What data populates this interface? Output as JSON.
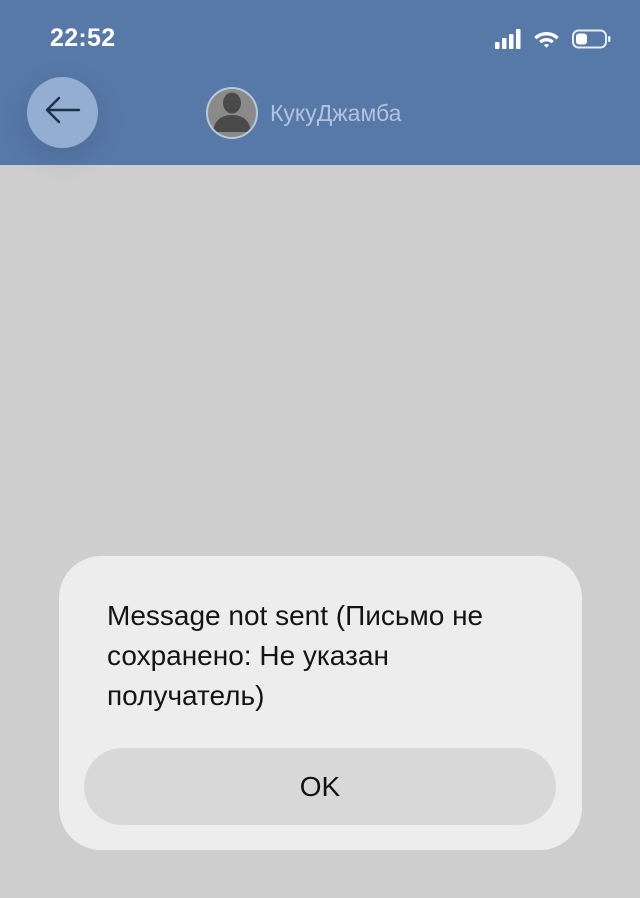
{
  "status_bar": {
    "time": "22:52",
    "icons": [
      "signal-icon",
      "wifi-icon",
      "battery-icon"
    ]
  },
  "header": {
    "back_icon": "arrow-left-icon",
    "contact_name": "КукуДжамба",
    "avatar_icon": "person-silhouette-icon"
  },
  "dialog": {
    "message": "Message not sent (Письмо не сохранено: Не указан получатель)",
    "ok_label": "OK"
  },
  "colors": {
    "header_bg": "#5779a8",
    "back_button_bg": "#93aed0",
    "page_bg": "#cecece",
    "dialog_bg": "#ededed",
    "ok_button_bg": "#d8d8d8"
  }
}
